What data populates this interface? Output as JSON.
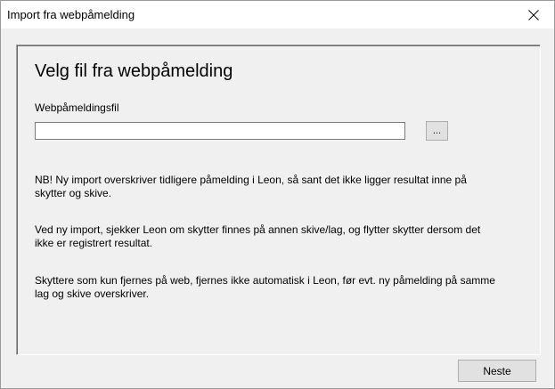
{
  "window": {
    "title": "Import fra webpåmelding",
    "close_icon": "close-icon"
  },
  "panel": {
    "heading": "Velg fil fra webpåmelding",
    "file_label": "Webpåmeldingsfil",
    "file_value": "",
    "browse_label": "...",
    "notes": [
      "NB! Ny import overskriver tidligere påmelding i Leon, så sant det ikke ligger resultat inne på skytter og skive.",
      "Ved ny import, sjekker Leon om skytter finnes på annen skive/lag, og flytter skytter dersom det ikke er registrert resultat.",
      "Skyttere som kun fjernes på web, fjernes ikke automatisk i Leon, før evt. ny påmelding på samme lag og skive overskriver."
    ]
  },
  "footer": {
    "next_label": "Neste"
  }
}
